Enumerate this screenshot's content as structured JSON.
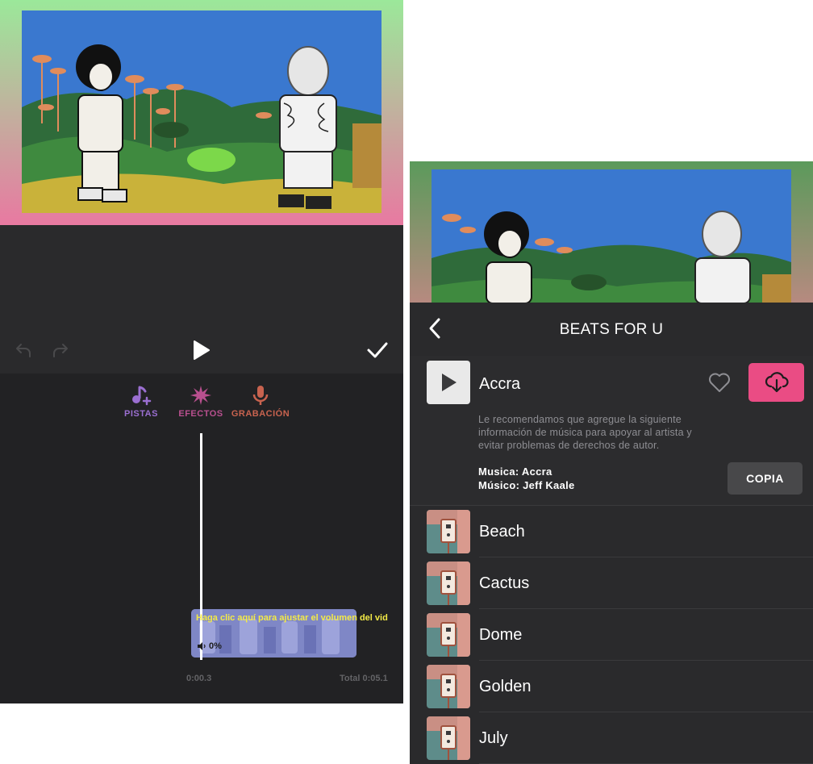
{
  "colors": {
    "accent_pink": "#ea4c84",
    "pistas": "#9b6fd1",
    "efectos": "#b9508f",
    "grabacion": "#c8634f",
    "hint_yellow": "#f3ea46"
  },
  "editor": {
    "modes": [
      {
        "label": "PISTAS",
        "icon": "music-plus-icon"
      },
      {
        "label": "EFECTOS",
        "icon": "burst-icon"
      },
      {
        "label": "GRABACIÓN",
        "icon": "microphone-icon"
      }
    ],
    "clip_hint": "Haga clic aquí para ajustar el volumen del vid",
    "clip_volume": "0%",
    "time_current": "0:00.3",
    "time_total": "Total 0:05.1"
  },
  "music": {
    "title": "BEATS FOR U",
    "selected": {
      "name": "Accra",
      "notice": "Le recomendamos que agregue la siguiente información de música para apoyar al artista y evitar problemas de derechos de autor.",
      "credit_music": "Musica: Accra",
      "credit_artist": "Músico: Jeff Kaale",
      "copy_label": "COPIA"
    },
    "tracks": [
      {
        "name": "Beach"
      },
      {
        "name": "Cactus"
      },
      {
        "name": "Dome"
      },
      {
        "name": "Golden"
      },
      {
        "name": "July"
      }
    ]
  }
}
